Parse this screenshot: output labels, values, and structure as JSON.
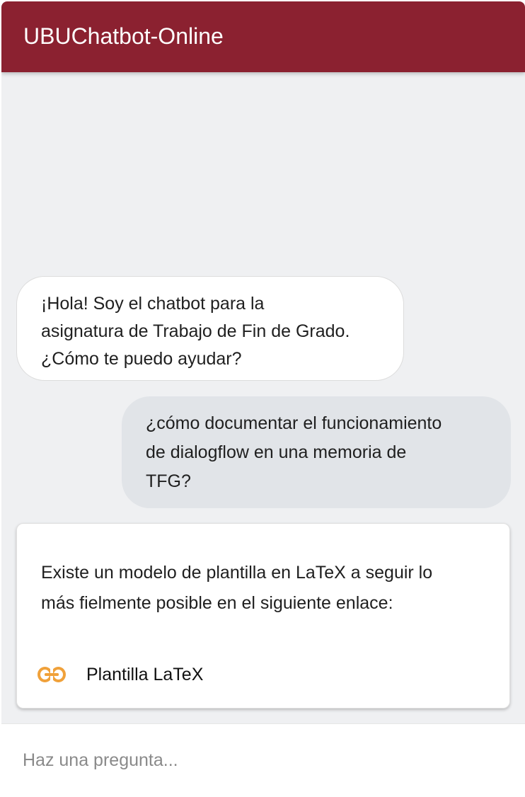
{
  "header": {
    "title": "UBUChatbot-Online",
    "background_color": "#8b2130"
  },
  "conversation": {
    "bot_greeting": {
      "lines": [
        "¡Hola! Soy el chatbot para la",
        "asignatura de Trabajo de Fin de Grado.",
        "¿Cómo te puedo ayudar?"
      ]
    },
    "user_question": {
      "lines": [
        "¿cómo documentar el funcionamiento",
        "de dialogflow en una memoria de",
        "TFG?"
      ]
    },
    "bot_card": {
      "lines": [
        "Existe un modelo de plantilla en LaTeX a seguir lo",
        "más fielmente posible en el siguiente enlace:"
      ],
      "link": {
        "icon": "link-icon",
        "label": "Plantilla LaTeX",
        "icon_color": "#f0a13a"
      }
    }
  },
  "input": {
    "placeholder": "Haz una pregunta...",
    "value": ""
  }
}
